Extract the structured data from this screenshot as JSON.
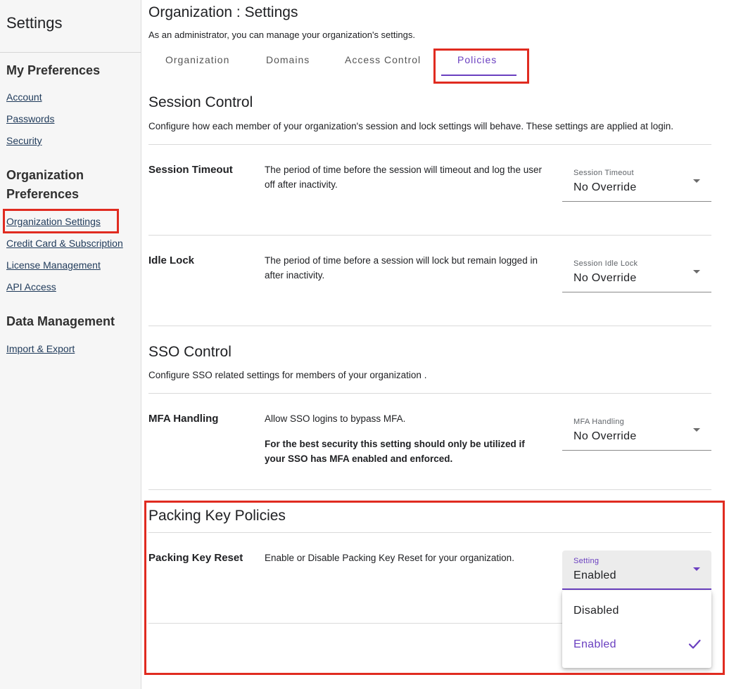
{
  "sidebar": {
    "title": "Settings",
    "sections": [
      {
        "heading": "My Preferences",
        "items": [
          "Account",
          "Passwords",
          "Security"
        ]
      },
      {
        "heading": "Organization Preferences",
        "items": [
          "Organization Settings",
          "Credit Card & Subscription",
          "License Management",
          "API Access"
        ]
      },
      {
        "heading": "Data Management",
        "items": [
          "Import & Export"
        ]
      }
    ]
  },
  "page": {
    "title": "Organization : Settings",
    "subtitle": "As an administrator, you can manage your organization's settings."
  },
  "tabs": [
    "Organization",
    "Domains",
    "Access Control",
    "Policies"
  ],
  "active_tab": "Policies",
  "session_control": {
    "title": "Session Control",
    "description": "Configure how each member of your organization's session and lock settings will behave. These settings are applied at login.",
    "rows": [
      {
        "label": "Session Timeout",
        "description": "The period of time before the session will timeout and log the user off after inactivity.",
        "field_label": "Session Timeout",
        "value": "No Override"
      },
      {
        "label": "Idle Lock",
        "description": "The period of time before a session will lock but remain logged in after inactivity.",
        "field_label": "Session Idle Lock",
        "value": "No Override"
      }
    ]
  },
  "sso_control": {
    "title": "SSO Control",
    "description": "Configure SSO related settings for members of your organization .",
    "row": {
      "label": "MFA Handling",
      "description": "Allow SSO logins to bypass MFA.",
      "note": "For the best security this setting should only be utilized if your SSO has MFA enabled and enforced.",
      "field_label": "MFA Handling",
      "value": "No Override"
    }
  },
  "packing_key": {
    "title": "Packing Key Policies",
    "row": {
      "label": "Packing Key Reset",
      "description": "Enable or Disable Packing Key Reset for your organization.",
      "field_label": "Setting",
      "value": "Enabled",
      "options": [
        "Disabled",
        "Enabled"
      ],
      "selected_option": "Enabled"
    }
  },
  "colors": {
    "accent": "#6a3fc0",
    "highlight": "#e02b20"
  }
}
